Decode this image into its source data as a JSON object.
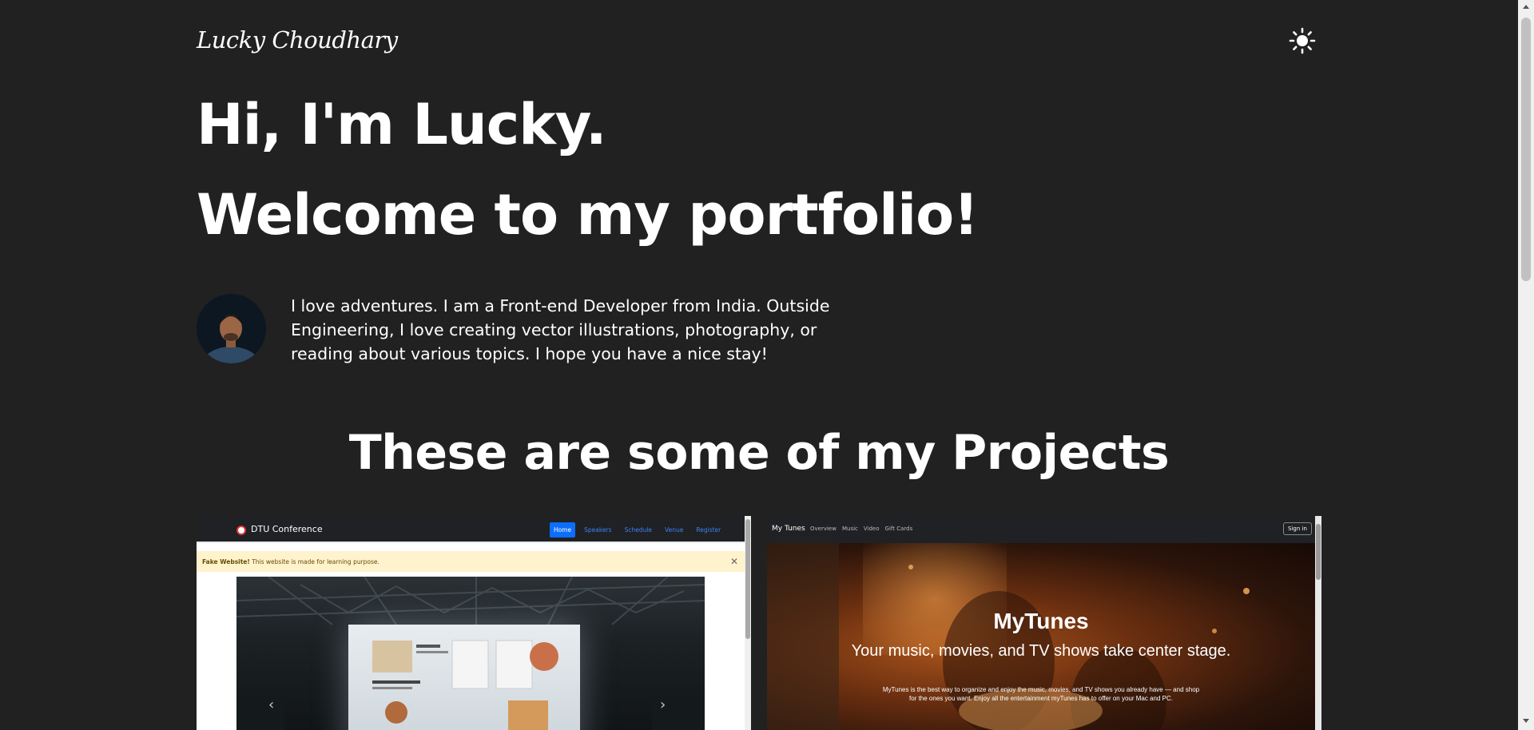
{
  "header": {
    "brand": "Lucky Choudhary",
    "theme_toggle_icon": "sun-icon"
  },
  "hero": {
    "line1": "Hi, I'm Lucky.",
    "line2": "Welcome to my portfolio!"
  },
  "about": {
    "avatar_icon": "avatar",
    "bio": "I love adventures. I am a Front-end Developer from India. Outside Engineering, I love creating vector illustrations, photography, or reading about various topics. I hope you have a nice stay!"
  },
  "projects": {
    "title": "These are some of my Projects",
    "items": [
      {
        "nav_title": "DTU Conference",
        "nav_links": [
          "Home",
          "Speakers",
          "Schedule",
          "Venue",
          "Register"
        ],
        "alert_bold": "Fake Website!",
        "alert_text": " This website is made for learning purpose.",
        "alert_close": "✕",
        "prev_arrow": "‹",
        "next_arrow": "›"
      },
      {
        "nav_brand": "My Tunes",
        "nav_links": [
          "Overview",
          "Music",
          "Video",
          "Gift Cards"
        ],
        "signin": "Sign in",
        "heading": "MyTunes",
        "subheading": "Your music, movies, and TV shows take center stage.",
        "description": "MyTunes is the best way to organize and enjoy the music, movies, and TV shows you already have — and shop for the ones you want. Enjoy all the entertainment myTunes has to offer on your Mac and PC."
      }
    ]
  },
  "colors": {
    "background": "#212121",
    "text": "#ffffff",
    "accent_blue": "#0d6efd"
  }
}
